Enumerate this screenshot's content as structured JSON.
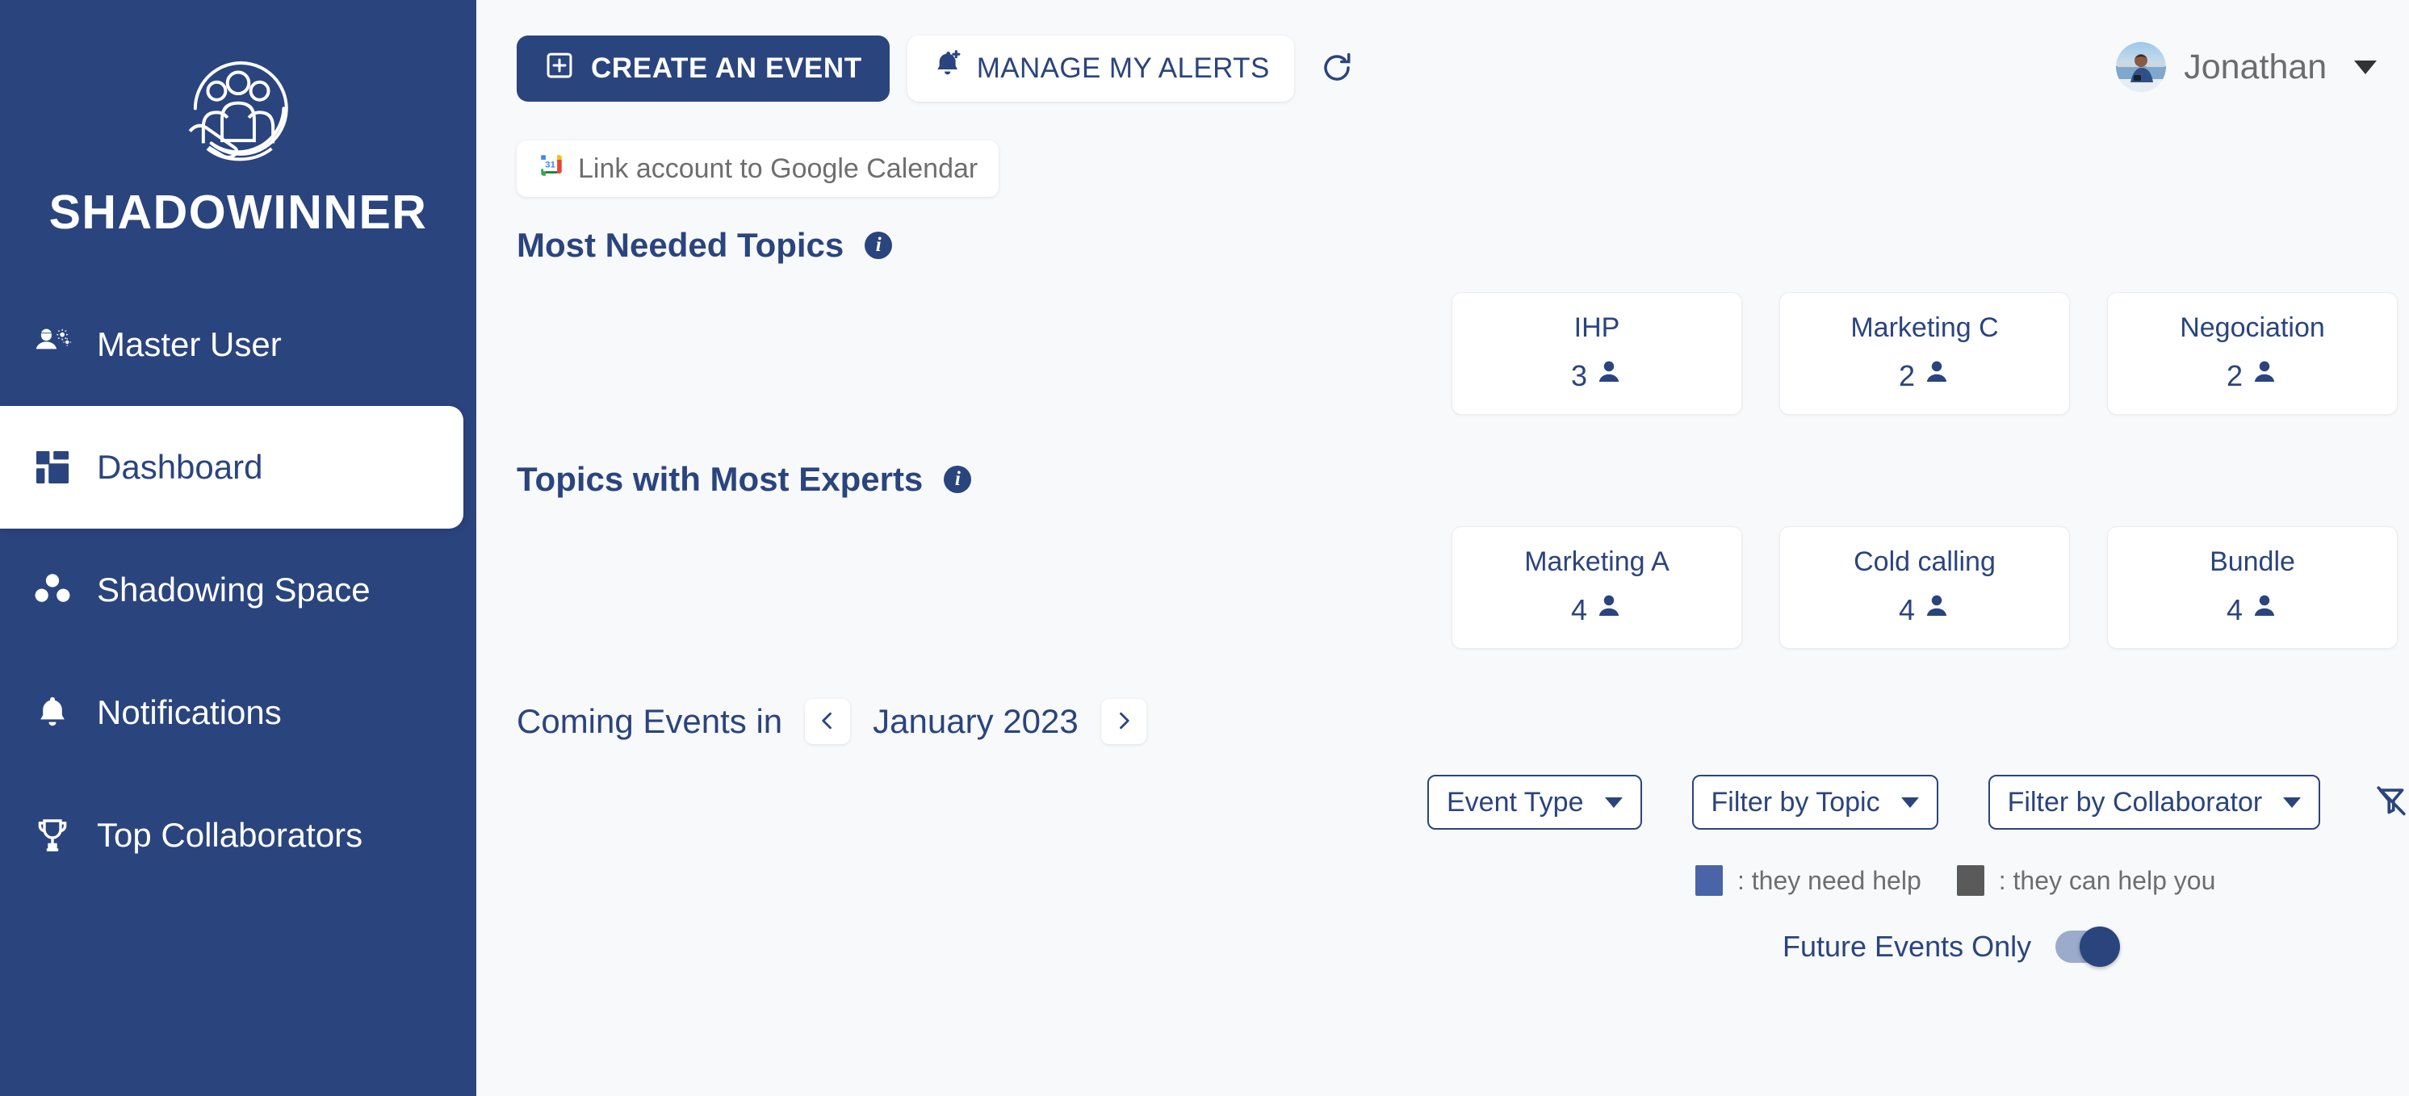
{
  "brand": {
    "name": "SHADOWINNER",
    "logo_icon": "people-in-hand-circle-logo"
  },
  "colors": {
    "sidebar_bg": "#2a447e",
    "page_bg": "#f8f9fb",
    "accent": "#2a447e",
    "legend_need_help": "#4a64a8",
    "legend_can_help": "#5a5a5a"
  },
  "sidebar": {
    "items": [
      {
        "label": "Master User",
        "icon": "user-settings-icon",
        "active": false
      },
      {
        "label": "Dashboard",
        "icon": "dashboard-grid-icon",
        "active": true
      },
      {
        "label": "Shadowing Space",
        "icon": "three-dots-group-icon",
        "active": false
      },
      {
        "label": "Notifications",
        "icon": "bell-icon",
        "active": false
      },
      {
        "label": "Top Collaborators",
        "icon": "trophy-icon",
        "active": false
      }
    ]
  },
  "toolbar": {
    "create_event_label": "CREATE AN EVENT",
    "create_event_icon": "square-plus-icon",
    "manage_alerts_label": "MANAGE MY ALERTS",
    "manage_alerts_icon": "bell-plus-icon",
    "refresh_icon": "refresh-icon"
  },
  "user": {
    "name": "Jonathan",
    "avatar_icon": "user-avatar-photo",
    "caret_icon": "chevron-down-icon"
  },
  "google_calendar": {
    "label": "Link account to Google Calendar",
    "icon": "google-calendar-icon"
  },
  "sections": [
    {
      "title": "Most Needed Topics",
      "info_icon": "info-icon",
      "cards": [
        {
          "name": "IHP",
          "count": "3",
          "icon": "person-icon"
        },
        {
          "name": "Marketing C",
          "count": "2",
          "icon": "person-icon"
        },
        {
          "name": "Negociation",
          "count": "2",
          "icon": "person-icon"
        }
      ]
    },
    {
      "title": "Topics with Most Experts",
      "info_icon": "info-icon",
      "cards": [
        {
          "name": "Marketing A",
          "count": "4",
          "icon": "person-icon"
        },
        {
          "name": "Cold calling",
          "count": "4",
          "icon": "person-icon"
        },
        {
          "name": "Bundle",
          "count": "4",
          "icon": "person-icon"
        }
      ]
    }
  ],
  "coming_events": {
    "label": "Coming Events in",
    "month": "January 2023",
    "prev_icon": "chevron-left-icon",
    "next_icon": "chevron-right-icon"
  },
  "filters": {
    "event_type": {
      "label": "Event Type"
    },
    "topic": {
      "label": "Filter by Topic"
    },
    "collaborator": {
      "label": "Filter by Collaborator"
    },
    "clear_icon": "clear-filter-icon"
  },
  "legend": [
    {
      "color": "#4a64a8",
      "text": ": they need help"
    },
    {
      "color": "#5a5a5a",
      "text": ": they can help you"
    }
  ],
  "future_events_toggle": {
    "label": "Future Events Only",
    "state": "on"
  }
}
